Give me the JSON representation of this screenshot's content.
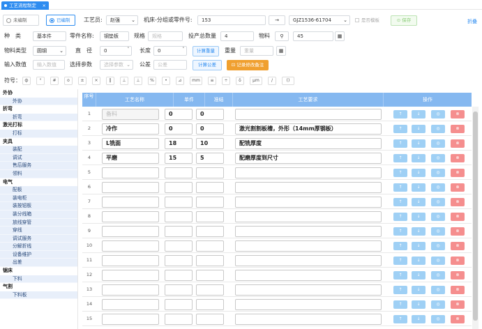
{
  "tab": {
    "title": "工艺流程制定",
    "close": "×"
  },
  "header": {
    "mode_unedited": "未编制",
    "mode_edited": "已编制",
    "craftsman_label": "工艺员:",
    "craftsman_value": "赵强",
    "machine_label": "机床-分组或零件号:",
    "machine_value": "153",
    "arrow": "→",
    "code_value": "GJZ1536-61704",
    "template_label": "是否模板",
    "save_label": "保存",
    "fold_label": "折叠"
  },
  "row2": {
    "kind_label": "种　类",
    "kind_value": "基本件",
    "part_label": "零件名称:",
    "part_value": "钢垫板",
    "spec_label": "规格",
    "spec_placeholder": "规格",
    "qty_label": "投产总数量",
    "qty_value": "4",
    "material_label": "物料",
    "material_value": "45"
  },
  "row3": {
    "mtype_label": "物料类型",
    "mtype_value": "圆钢",
    "dia_label": "直　径",
    "dia_value": "0",
    "len_label": "长度",
    "len_value": "0",
    "calc_weight": "计算重量",
    "weight_label": "重量",
    "weight_placeholder": "重量"
  },
  "row4": {
    "input_label": "输入数值",
    "input_placeholder": "输入数值",
    "param_label": "选择参数",
    "param_placeholder": "选择参数",
    "formula_label": "公差",
    "formula_placeholder": "公差",
    "calc_formula": "计算公差",
    "record_btn": "记录修改备注"
  },
  "symbols": {
    "label": "符号：",
    "items": [
      "ф",
      "°",
      "#",
      "o",
      "±",
      "×",
      "‖",
      "⊥",
      "⊥",
      "%",
      "•",
      "⊿",
      "mm",
      "≡",
      "÷",
      "δ",
      "μm",
      "/",
      "()"
    ]
  },
  "sidebar": {
    "items": [
      {
        "t": "g",
        "label": "外协"
      },
      {
        "t": "s",
        "label": "外协"
      },
      {
        "t": "g",
        "label": "折弯"
      },
      {
        "t": "s",
        "label": "折弯"
      },
      {
        "t": "g",
        "label": "激光打标"
      },
      {
        "t": "s",
        "label": "打标"
      },
      {
        "t": "g",
        "label": "夹具"
      },
      {
        "t": "s",
        "label": "装配"
      },
      {
        "t": "s",
        "label": "调试"
      },
      {
        "t": "s",
        "label": "售后服务"
      },
      {
        "t": "s",
        "label": "领料"
      },
      {
        "t": "g",
        "label": "电气"
      },
      {
        "t": "s",
        "label": "配板"
      },
      {
        "t": "s",
        "label": "装电柜"
      },
      {
        "t": "s",
        "label": "装按钮板"
      },
      {
        "t": "s",
        "label": "装分线箱"
      },
      {
        "t": "s",
        "label": "放线穿管"
      },
      {
        "t": "s",
        "label": "穿线"
      },
      {
        "t": "s",
        "label": "调试服务"
      },
      {
        "t": "s",
        "label": "分解折线"
      },
      {
        "t": "s",
        "label": "设备维护"
      },
      {
        "t": "s",
        "label": "出差"
      },
      {
        "t": "g",
        "label": "锯床"
      },
      {
        "t": "s",
        "label": "下料"
      },
      {
        "t": "g",
        "label": "气割"
      },
      {
        "t": "s",
        "label": "下料板"
      }
    ]
  },
  "table": {
    "headers": [
      "序号",
      "工艺名称",
      "单件",
      "准结",
      "工艺要求",
      "操作"
    ],
    "name_placeholder": "备料",
    "ops": [
      "↑",
      "↓",
      "◎",
      "⊗"
    ],
    "rows": [
      {
        "no": "1",
        "name": "",
        "single": "0",
        "prep": "0",
        "req": ""
      },
      {
        "no": "2",
        "name": "冷作",
        "single": "0",
        "prep": "0",
        "req": "激光割割板槽，外形（14mm厚钢板）"
      },
      {
        "no": "3",
        "name": "L铣面",
        "single": "18",
        "prep": "10",
        "req": "配铣厚度"
      },
      {
        "no": "4",
        "name": "平磨",
        "single": "15",
        "prep": "5",
        "req": "配磨厚度到尺寸"
      },
      {
        "no": "5",
        "name": "",
        "single": "",
        "prep": "",
        "req": ""
      },
      {
        "no": "6",
        "name": "",
        "single": "",
        "prep": "",
        "req": ""
      },
      {
        "no": "7",
        "name": "",
        "single": "",
        "prep": "",
        "req": ""
      },
      {
        "no": "8",
        "name": "",
        "single": "",
        "prep": "",
        "req": ""
      },
      {
        "no": "9",
        "name": "",
        "single": "",
        "prep": "",
        "req": ""
      },
      {
        "no": "10",
        "name": "",
        "single": "",
        "prep": "",
        "req": ""
      },
      {
        "no": "11",
        "name": "",
        "single": "",
        "prep": "",
        "req": ""
      },
      {
        "no": "12",
        "name": "",
        "single": "",
        "prep": "",
        "req": ""
      },
      {
        "no": "13",
        "name": "",
        "single": "",
        "prep": "",
        "req": ""
      },
      {
        "no": "14",
        "name": "",
        "single": "",
        "prep": "",
        "req": ""
      },
      {
        "no": "15",
        "name": "",
        "single": "",
        "prep": "",
        "req": ""
      }
    ]
  }
}
